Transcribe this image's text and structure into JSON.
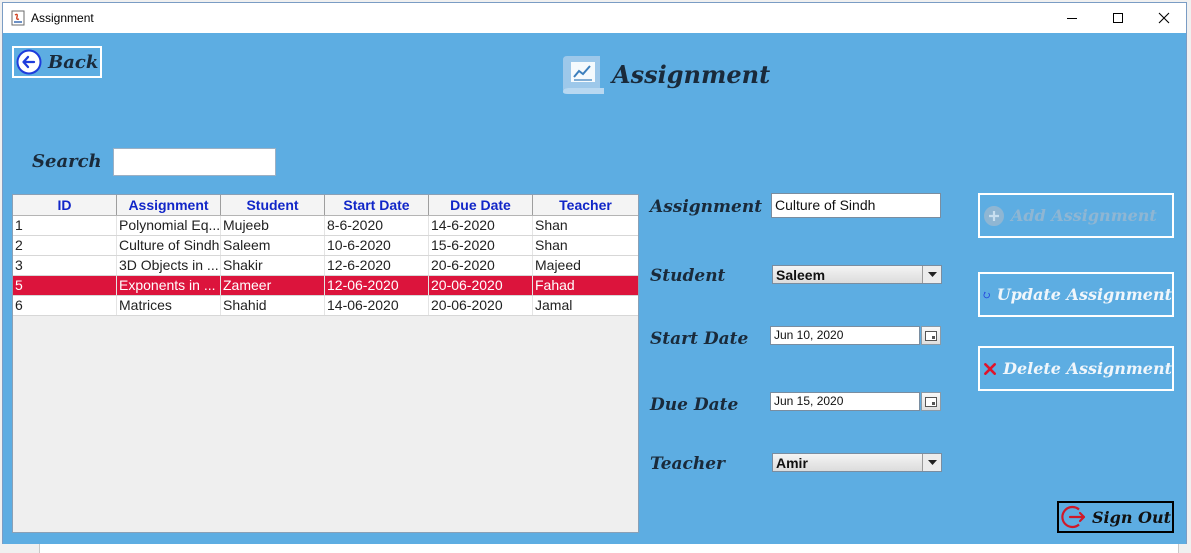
{
  "window": {
    "title": "Assignment"
  },
  "header": {
    "title": "Assignment",
    "back_label": "Back"
  },
  "search": {
    "label": "Search",
    "value": ""
  },
  "table": {
    "columns": [
      "ID",
      "Assignment",
      "Student",
      "Start Date",
      "Due Date",
      "Teacher"
    ],
    "rows": [
      [
        "1",
        "Polynomial Eq...",
        "Mujeeb",
        "8-6-2020",
        "14-6-2020",
        "Shan"
      ],
      [
        "2",
        "Culture of Sindh",
        "Saleem",
        "10-6-2020",
        "15-6-2020",
        "Shan"
      ],
      [
        "3",
        "3D Objects in ...",
        "Shakir",
        "12-6-2020",
        "20-6-2020",
        "Majeed"
      ],
      [
        "5",
        "Exponents in ...",
        "Zameer",
        "12-06-2020",
        "20-06-2020",
        "Fahad"
      ],
      [
        "6",
        "Matrices",
        "Shahid",
        "14-06-2020",
        "20-06-2020",
        "Jamal"
      ]
    ],
    "selected_row": 3
  },
  "form": {
    "assignment_label": "Assignment",
    "assignment_value": "Culture of Sindh",
    "student_label": "Student",
    "student_value": "Saleem",
    "start_date_label": "Start Date",
    "start_date_value": "Jun 10, 2020",
    "due_date_label": "Due Date",
    "due_date_value": "Jun 15, 2020",
    "teacher_label": "Teacher",
    "teacher_value": "Amir"
  },
  "actions": {
    "add_label": "Add Assignment",
    "update_label": "Update Assignment",
    "delete_label": "Delete Assignment",
    "signout_label": "Sign Out"
  },
  "colors": {
    "background": "#5dade2",
    "header_text": "#1126c8",
    "selected_row": "#dc143c",
    "delete_icon": "#e0142c",
    "update_icon": "#1e3cdc",
    "signout_icon": "#d01828"
  },
  "icons": {
    "back": "arrow-left-circle-icon",
    "logo": "chart-document-icon",
    "add": "plus-circle-icon",
    "update": "refresh-icon",
    "delete": "x-icon",
    "signout": "logout-icon",
    "calendar": "calendar-icon",
    "dropdown": "chevron-down-icon"
  }
}
